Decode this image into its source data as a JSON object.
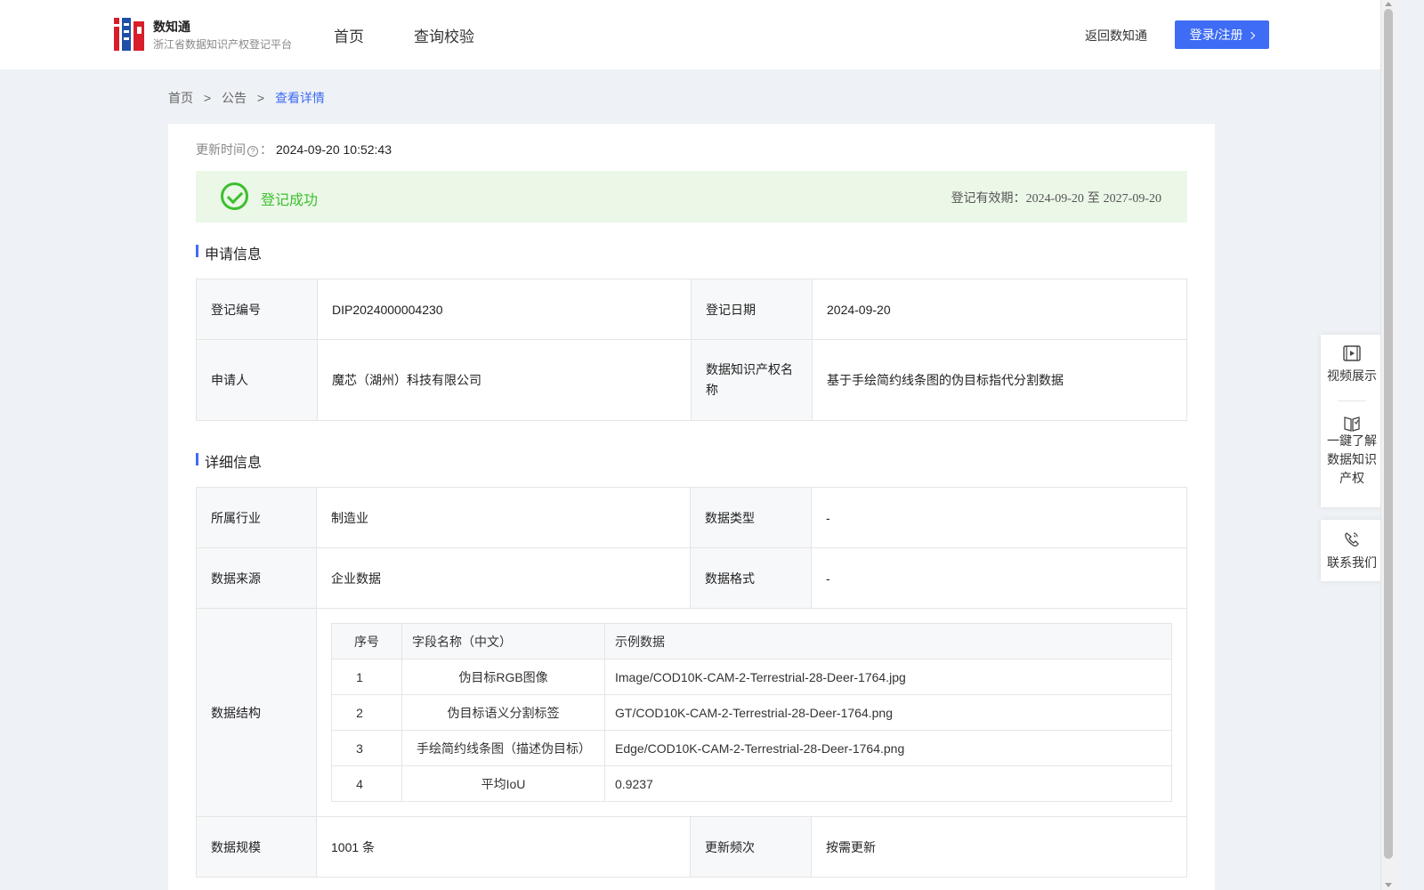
{
  "header": {
    "brand_name": "数知通",
    "brand_sub": "浙江省数据知识产权登记平台",
    "nav": [
      "首页",
      "查询校验"
    ],
    "back_link": "返回数知通",
    "login_label": "登录/注册"
  },
  "breadcrumb": {
    "items": [
      "首页",
      "公告",
      "查看详情"
    ],
    "separator": ">"
  },
  "card": {
    "updated_label": "更新时间",
    "updated_colon": "：",
    "updated_value": "2024-09-20 10:52:43",
    "status": "登记成功",
    "validity_label": "登记有效期：",
    "validity_from": "2024-09-20",
    "validity_to_word": "至",
    "validity_to": "2027-09-20",
    "section_apply": "申请信息",
    "section_detail": "详细信息"
  },
  "apply": {
    "reg_no_label": "登记编号",
    "reg_no": "DIP2024000004230",
    "reg_date_label": "登记日期",
    "reg_date": "2024-09-20",
    "applicant_label": "申请人",
    "applicant": "魔芯（湖州）科技有限公司",
    "ip_name_label": "数据知识产权名称",
    "ip_name": "基于手绘简约线条图的伪目标指代分割数据"
  },
  "detail": {
    "industry_label": "所属行业",
    "industry": "制造业",
    "data_type_label": "数据类型",
    "data_type": "-",
    "source_label": "数据来源",
    "source": "企业数据",
    "format_label": "数据格式",
    "format": "-",
    "structure_label": "数据结构",
    "scale_label": "数据规模",
    "scale": "1001 条",
    "freq_label": "更新频次",
    "freq": "按需更新"
  },
  "structure": {
    "headers": [
      "序号",
      "字段名称（中文）",
      "示例数据"
    ],
    "rows": [
      [
        "1",
        "伪目标RGB图像",
        "Image/COD10K-CAM-2-Terrestrial-28-Deer-1764.jpg"
      ],
      [
        "2",
        "伪目标语义分割标签",
        "GT/COD10K-CAM-2-Terrestrial-28-Deer-1764.png"
      ],
      [
        "3",
        "手绘简约线条图（描述伪目标）",
        "Edge/COD10K-CAM-2-Terrestrial-28-Deer-1764.png"
      ],
      [
        "4",
        "平均IoU",
        "0.9237"
      ]
    ]
  },
  "float": {
    "video": "视频展示",
    "learn": [
      "一鍵了解",
      "数据知识",
      "产权"
    ],
    "contact": "联系我们"
  },
  "colors": {
    "accent": "#3e6cf5",
    "success": "#3cbf2e",
    "success_bg": "#ebf7e7"
  }
}
